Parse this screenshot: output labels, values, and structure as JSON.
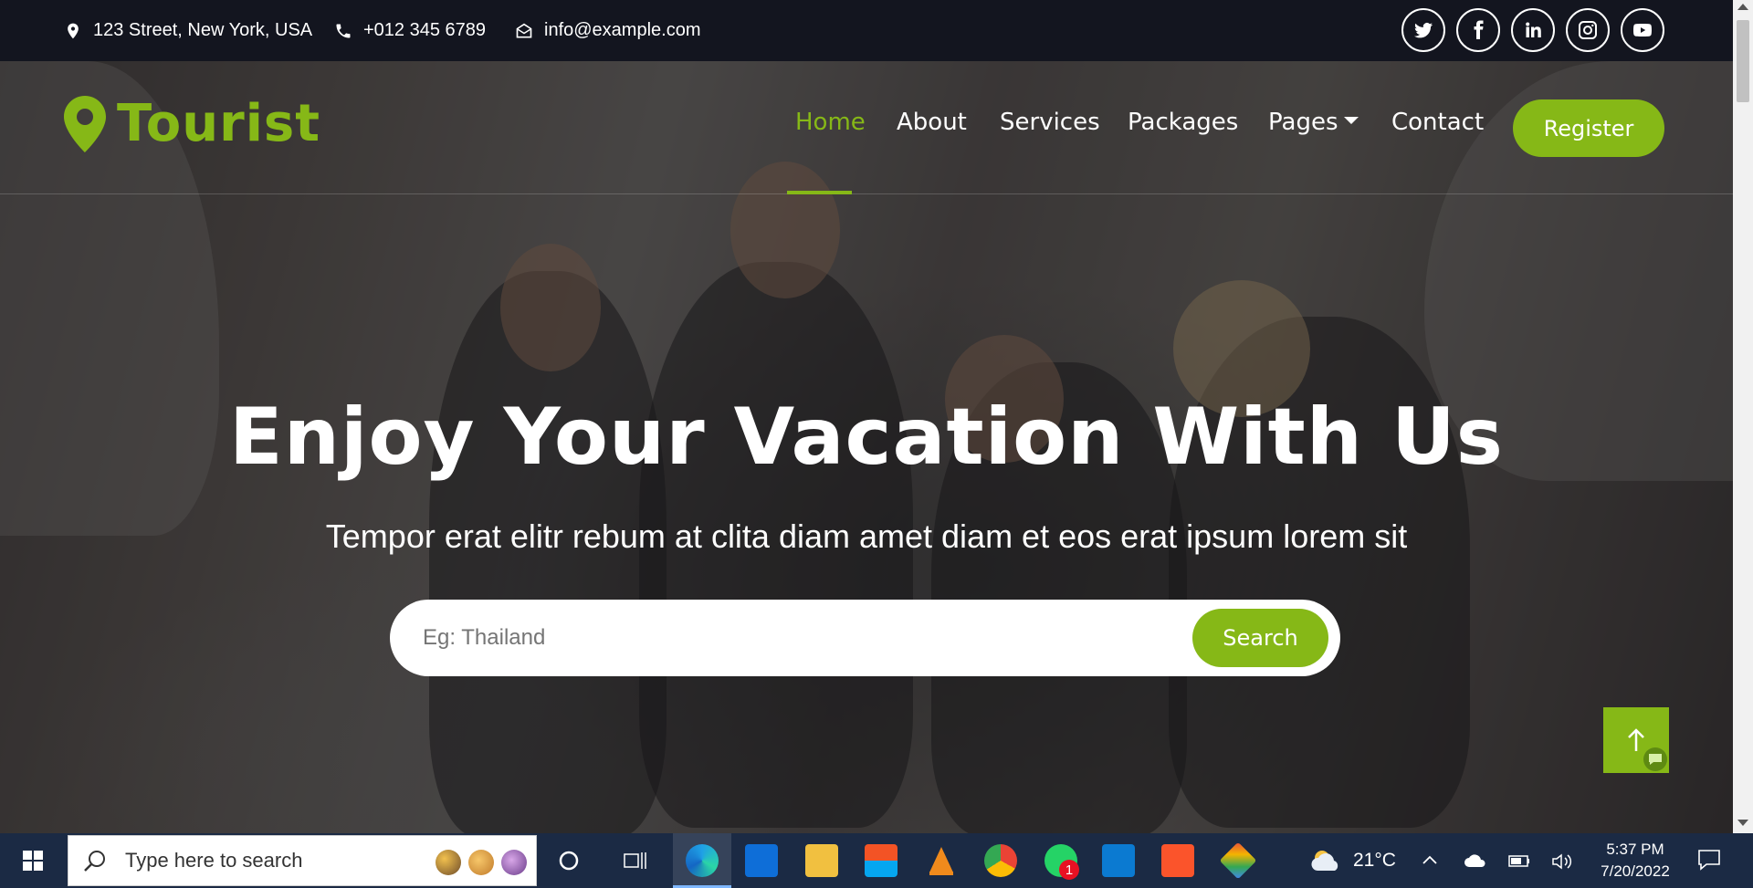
{
  "topbar": {
    "address": "123 Street, New York, USA",
    "phone": "+012 345 6789",
    "email": "info@example.com",
    "social": [
      "twitter-icon",
      "facebook-icon",
      "linkedin-icon",
      "instagram-icon",
      "youtube-icon"
    ]
  },
  "brand": {
    "name": "Tourist",
    "accent": "#86b817"
  },
  "nav": {
    "items": [
      {
        "label": "Home",
        "active": true
      },
      {
        "label": "About"
      },
      {
        "label": "Services"
      },
      {
        "label": "Packages"
      },
      {
        "label": "Pages"
      },
      {
        "label": "Contact"
      }
    ],
    "register_label": "Register"
  },
  "hero": {
    "title": "Enjoy Your Vacation With Us",
    "subtitle": "Tempor erat elitr rebum at clita diam amet diam et eos erat ipsum lorem sit",
    "search_placeholder": "Eg: Thailand",
    "search_label": "Search"
  },
  "taskbar": {
    "search_placeholder": "Type here to search",
    "weather_temp": "21°C",
    "time": "5:37 PM",
    "date": "7/20/2022",
    "whatsapp_badge": "1"
  }
}
